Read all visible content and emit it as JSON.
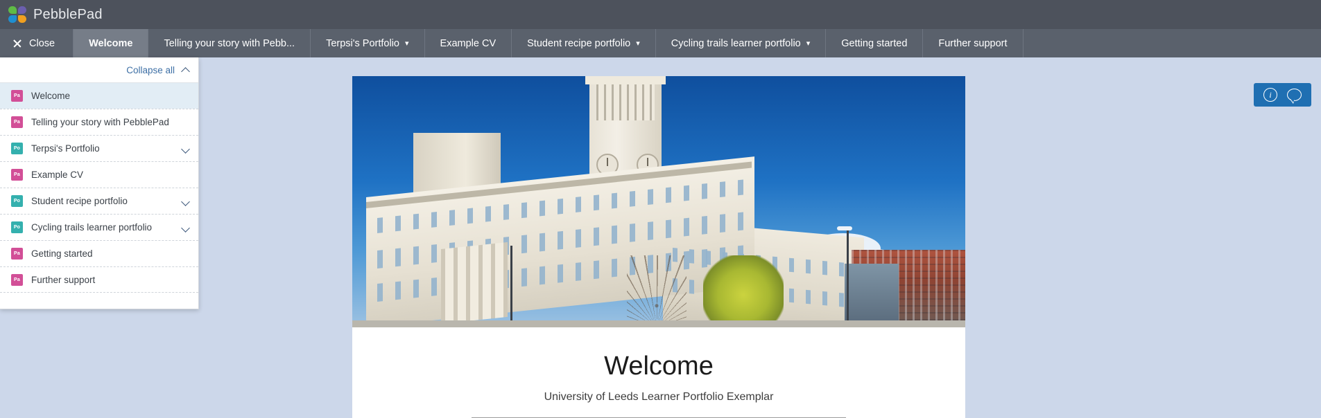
{
  "brand": {
    "name": "PebblePad",
    "logo_icon": "pebblepad-logo-icon",
    "logo_colors": [
      "#5fbb46",
      "#6b5fae",
      "#1f8fd0",
      "#f0a020"
    ],
    "bar_color": "#4d525c"
  },
  "tabbar": {
    "bar_color": "#5a616c",
    "active_color": "#767d88",
    "close_label": "Close",
    "close_icon": "close-x-icon",
    "tabs": [
      {
        "label": "Welcome",
        "active": true,
        "has_caret": false
      },
      {
        "label": "Telling your story with Pebb...",
        "active": false,
        "has_caret": false
      },
      {
        "label": "Terpsi's Portfolio",
        "active": false,
        "has_caret": true
      },
      {
        "label": "Example CV",
        "active": false,
        "has_caret": false
      },
      {
        "label": "Student recipe portfolio",
        "active": false,
        "has_caret": true
      },
      {
        "label": "Cycling trails learner portfolio",
        "active": false,
        "has_caret": true
      },
      {
        "label": "Getting started",
        "active": false,
        "has_caret": false
      },
      {
        "label": "Further support",
        "active": false,
        "has_caret": false
      }
    ]
  },
  "navpanel": {
    "collapse_all_label": "Collapse all",
    "collapse_all_icon": "chevron-up-icon",
    "link_color": "#3d6fa5",
    "items": [
      {
        "label": "Welcome",
        "badge": "Pa",
        "badge_kind": "pink",
        "selected": true,
        "has_caret": false
      },
      {
        "label": "Telling your story with PebblePad",
        "badge": "Pa",
        "badge_kind": "pink",
        "selected": false,
        "has_caret": false
      },
      {
        "label": "Terpsi's Portfolio",
        "badge": "Po",
        "badge_kind": "teal",
        "selected": false,
        "has_caret": true
      },
      {
        "label": "Example CV",
        "badge": "Pa",
        "badge_kind": "pink",
        "selected": false,
        "has_caret": false
      },
      {
        "label": "Student recipe portfolio",
        "badge": "Po",
        "badge_kind": "teal",
        "selected": false,
        "has_caret": true
      },
      {
        "label": "Cycling trails learner portfolio",
        "badge": "Po",
        "badge_kind": "teal",
        "selected": false,
        "has_caret": true
      },
      {
        "label": "Getting started",
        "badge": "Pa",
        "badge_kind": "pink",
        "selected": false,
        "has_caret": false
      },
      {
        "label": "Further support",
        "badge": "Pa",
        "badge_kind": "pink",
        "selected": false,
        "has_caret": false
      }
    ]
  },
  "document": {
    "banner_image_alt": "Parkinson Building, University of Leeds, under a clear blue sky",
    "title": "Welcome",
    "subtitle": "University of Leeds Learner Portfolio Exemplar"
  },
  "actions": {
    "pill_color": "#1f6fb2",
    "info_icon": "info-circle-icon",
    "info_glyph": "i",
    "comment_icon": "comment-bubble-icon"
  },
  "page": {
    "background": "#ccd7ea"
  }
}
